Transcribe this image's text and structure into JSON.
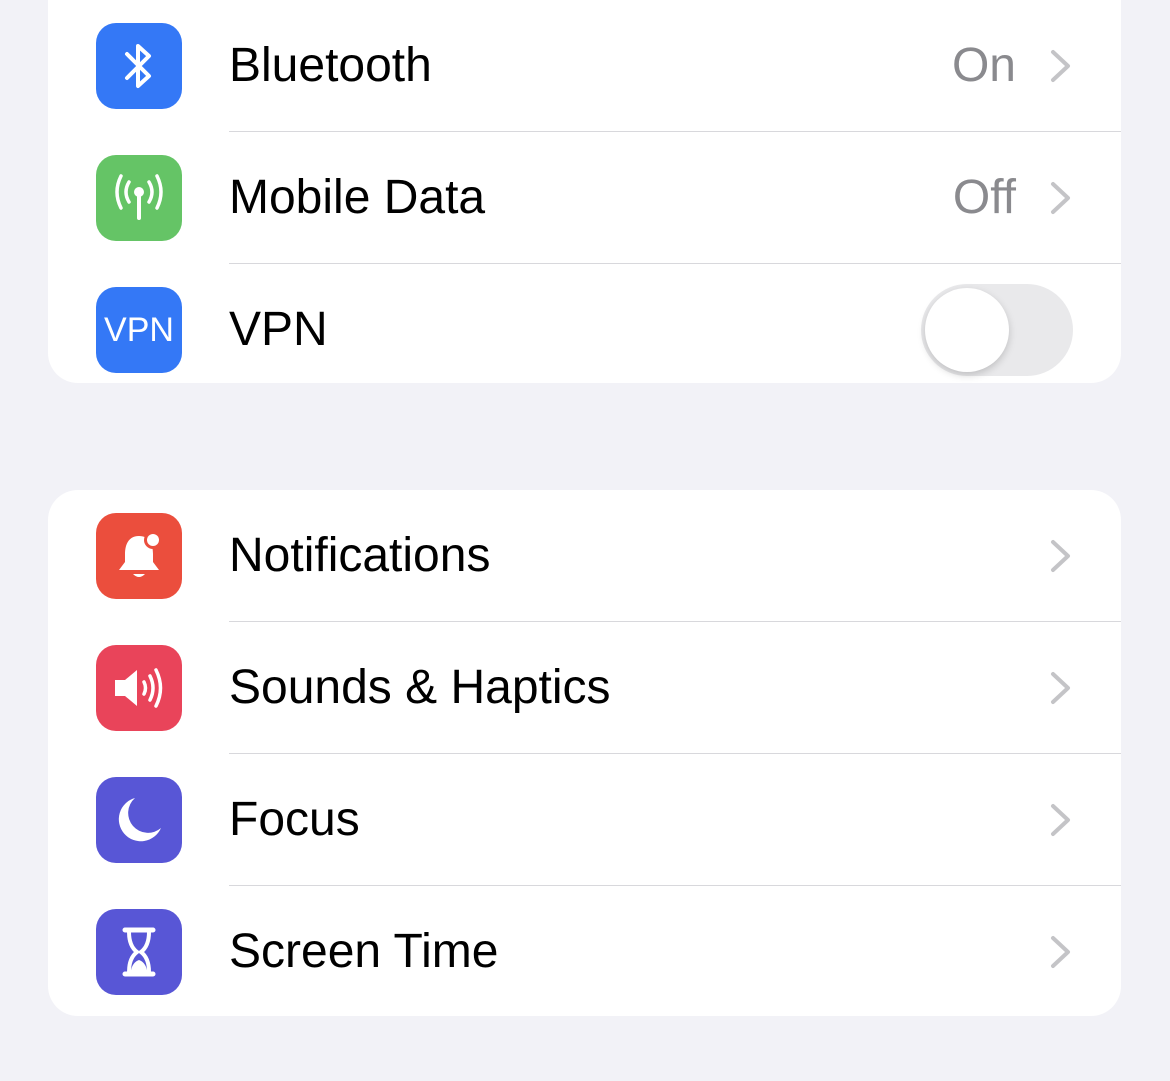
{
  "connectivity": [
    {
      "label": "Bluetooth",
      "value": "On",
      "icon": "bluetooth-icon",
      "color": "#3478f6"
    },
    {
      "label": "Mobile Data",
      "value": "Off",
      "icon": "antenna-icon",
      "color": "#65c466"
    },
    {
      "label": "VPN",
      "icon_text": "VPN",
      "icon": "vpn-icon",
      "color": "#3478f6",
      "toggle_on": false
    }
  ],
  "general": [
    {
      "label": "Notifications",
      "icon": "bell-badge-icon",
      "color": "#eb4e3d"
    },
    {
      "label": "Sounds & Haptics",
      "icon": "speaker-icon",
      "color": "#e9445a"
    },
    {
      "label": "Focus",
      "icon": "moon-icon",
      "color": "#5856d6"
    },
    {
      "label": "Screen Time",
      "icon": "hourglass-icon",
      "color": "#5856d6"
    }
  ],
  "colors": {
    "background": "#f2f2f7",
    "secondary_text": "#8a8a8e",
    "chevron": "#c4c4c7"
  }
}
